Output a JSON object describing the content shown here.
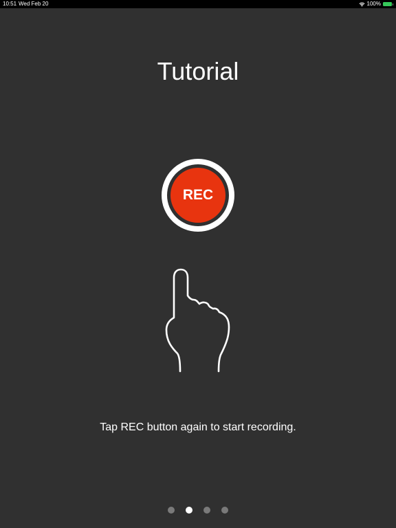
{
  "status_bar": {
    "time": "10:51",
    "date": "Wed Feb 20",
    "battery": "100%",
    "battery_color": "#36c85a"
  },
  "tutorial": {
    "title": "Tutorial",
    "rec_label": "REC",
    "instruction": "Tap REC button again to start recording.",
    "accent_color": "#e8340f"
  },
  "pagination": {
    "total_pages": 4,
    "current_page": 2
  }
}
